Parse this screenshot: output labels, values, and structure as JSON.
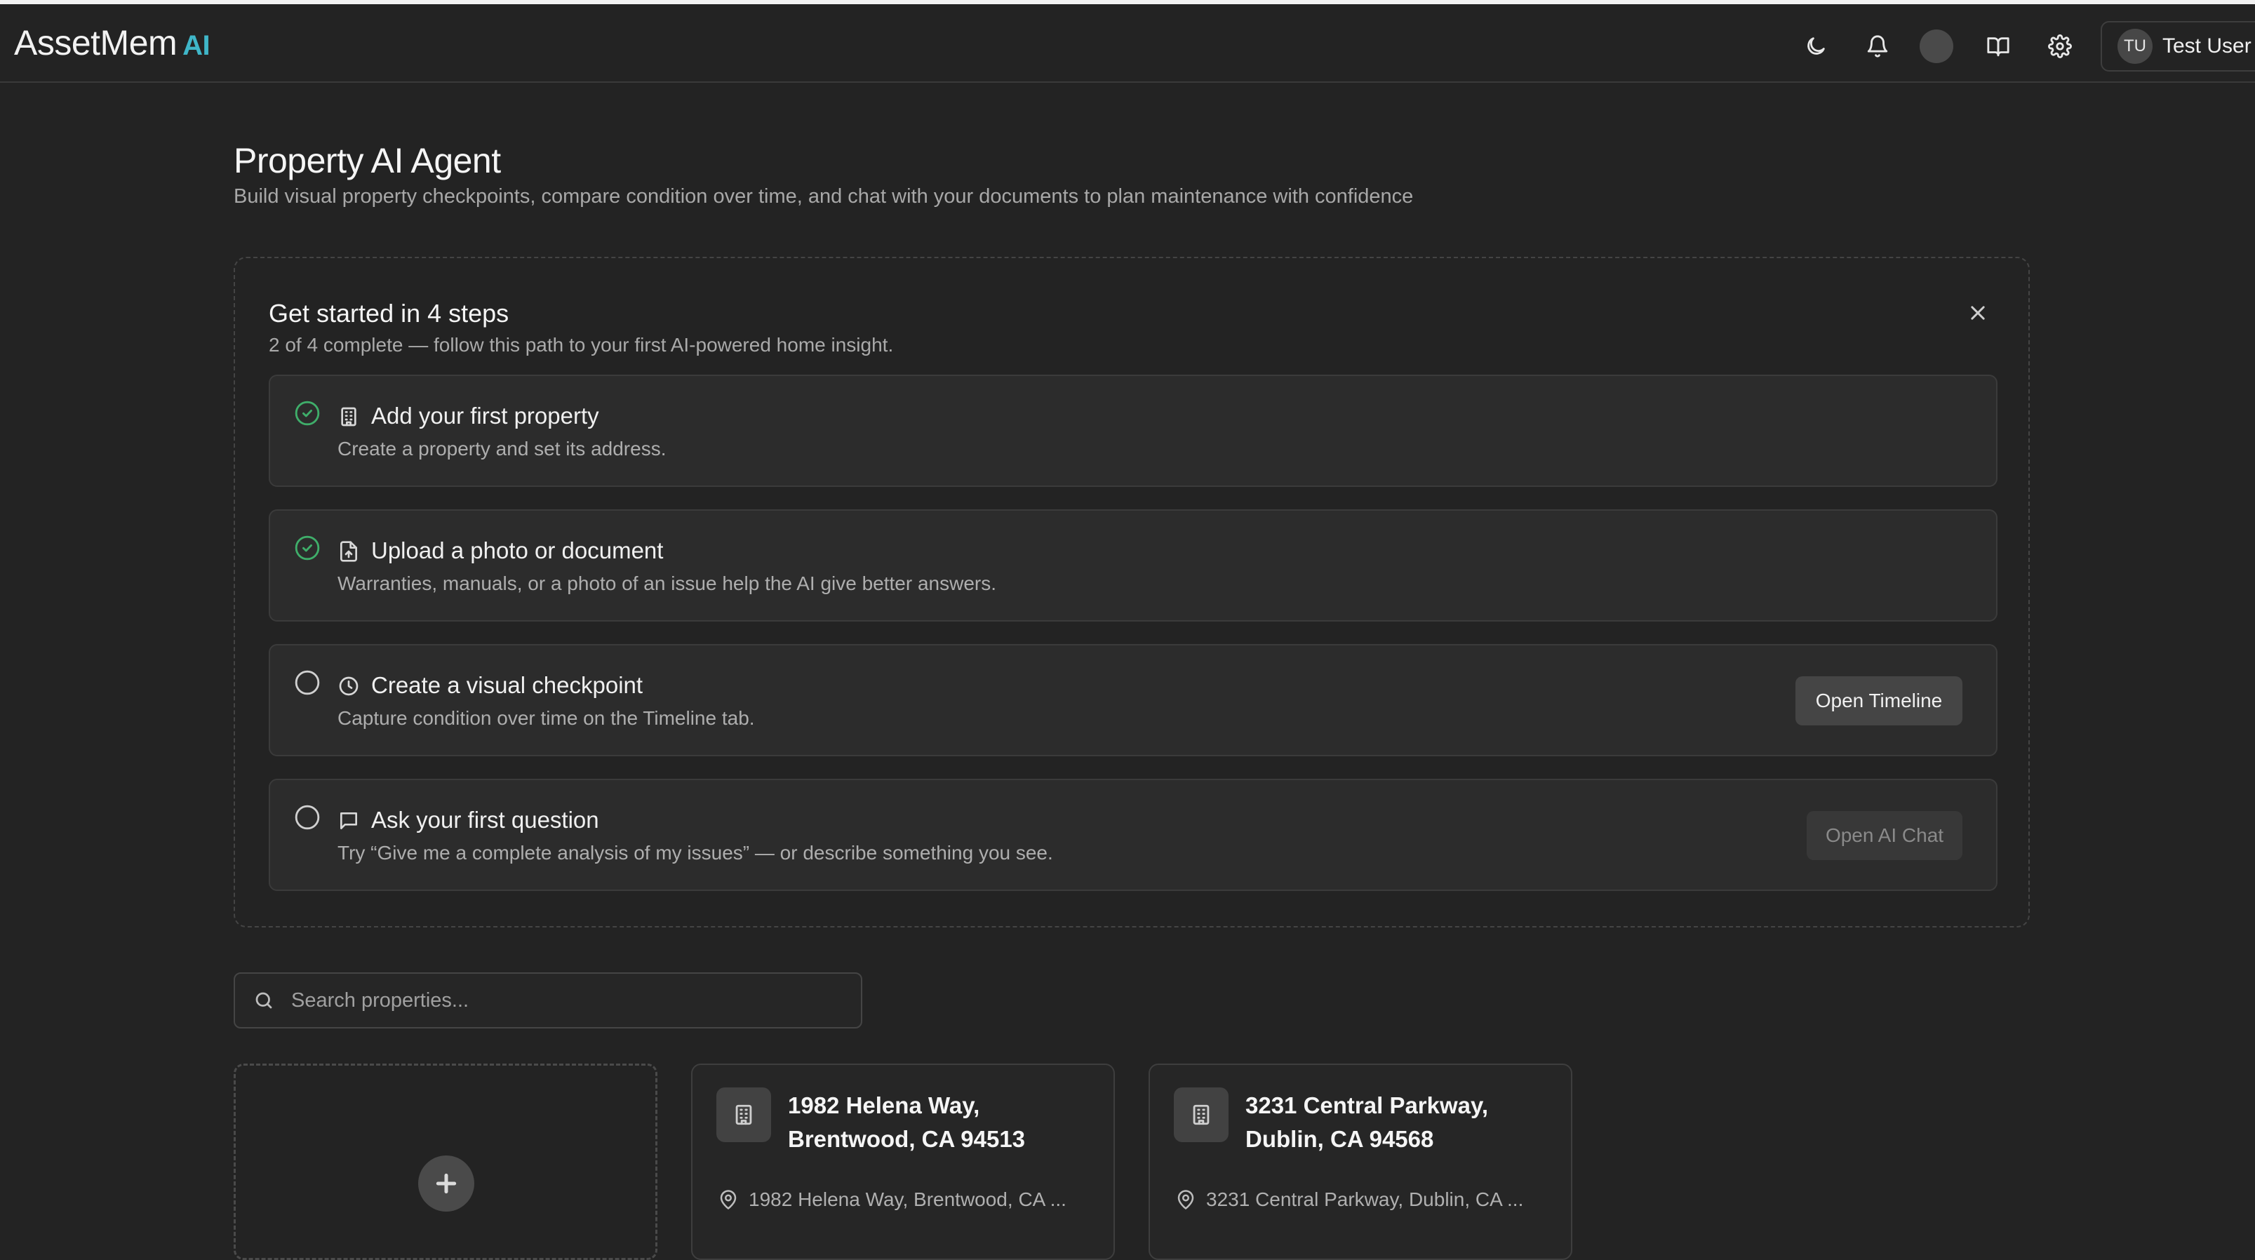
{
  "header": {
    "brand": "AssetMem",
    "brand_suffix": "AI",
    "user": {
      "initials": "TU",
      "name": "Test User"
    },
    "icons": [
      "moon-icon",
      "bell-icon",
      "status-dot",
      "book-icon",
      "gear-icon"
    ]
  },
  "page": {
    "title": "Property AI Agent",
    "subtitle": "Build visual property checkpoints, compare condition over time, and chat with your documents to plan maintenance with confidence"
  },
  "onboarding": {
    "title": "Get started in 4 steps",
    "progress_text": "2 of 4 complete — follow this path to your first AI-powered home insight.",
    "steps": [
      {
        "title": "Add your first property",
        "description": "Create a property and set its address.",
        "complete": true,
        "icon": "building-icon"
      },
      {
        "title": "Upload a photo or document",
        "description": "Warranties, manuals, or a photo of an issue help the AI give better answers.",
        "complete": true,
        "icon": "file-upload-icon"
      },
      {
        "title": "Create a visual checkpoint",
        "description": "Capture condition over time on the Timeline tab.",
        "complete": false,
        "icon": "clock-icon",
        "action": "Open Timeline"
      },
      {
        "title": "Ask your first question",
        "description": "Try “Give me a complete analysis of my issues” — or describe something you see.",
        "complete": false,
        "icon": "chat-icon",
        "action": "Open AI Chat",
        "action_disabled": true
      }
    ]
  },
  "search": {
    "placeholder": "Search properties..."
  },
  "properties": [
    {
      "name": "1982 Helena Way, Brentwood, CA 94513",
      "address": "1982 Helena Way, Brentwood, CA ..."
    },
    {
      "name": "3231 Central Parkway, Dublin, CA 94568",
      "address": "3231 Central Parkway, Dublin, CA ..."
    }
  ],
  "colors": {
    "accent": "#3fb6c8",
    "complete": "#3fae6a",
    "background": "#232323"
  }
}
